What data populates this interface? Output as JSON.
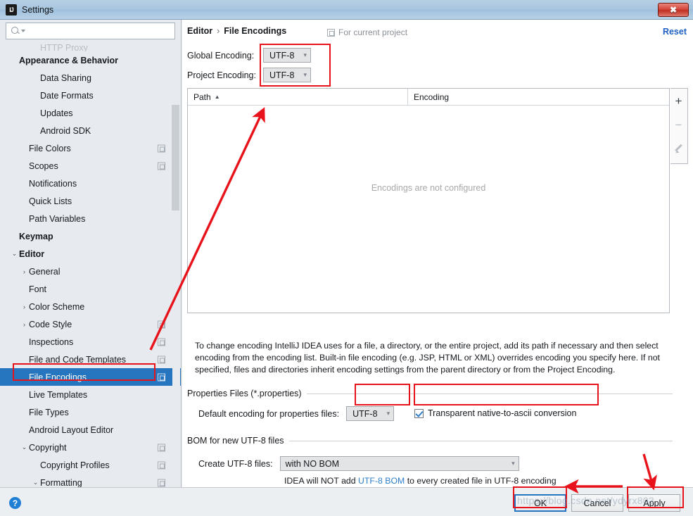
{
  "window": {
    "title": "Settings",
    "app_icon": "intellij-idea-icon",
    "close_label": "✖"
  },
  "sidebar": {
    "search": {
      "placeholder": "",
      "value": "",
      "icon": "search-icon"
    },
    "items": [
      {
        "label": "HTTP Proxy",
        "indent": 2,
        "kind": "clipped",
        "arrow": "",
        "badge": false
      },
      {
        "label": "Appearance & Behavior",
        "indent": 0,
        "kind": "group",
        "arrow": "",
        "badge": false
      },
      {
        "label": "Data Sharing",
        "indent": 2,
        "kind": "leaf",
        "arrow": "",
        "badge": false
      },
      {
        "label": "Date Formats",
        "indent": 2,
        "kind": "leaf",
        "arrow": "",
        "badge": false
      },
      {
        "label": "Updates",
        "indent": 2,
        "kind": "leaf",
        "arrow": "",
        "badge": false
      },
      {
        "label": "Android SDK",
        "indent": 2,
        "kind": "leaf",
        "arrow": "",
        "badge": false
      },
      {
        "label": "File Colors",
        "indent": 1,
        "kind": "leaf",
        "arrow": "",
        "badge": true
      },
      {
        "label": "Scopes",
        "indent": 1,
        "kind": "leaf",
        "arrow": "",
        "badge": true
      },
      {
        "label": "Notifications",
        "indent": 1,
        "kind": "leaf",
        "arrow": "",
        "badge": false
      },
      {
        "label": "Quick Lists",
        "indent": 1,
        "kind": "leaf",
        "arrow": "",
        "badge": false
      },
      {
        "label": "Path Variables",
        "indent": 1,
        "kind": "leaf",
        "arrow": "",
        "badge": false
      },
      {
        "label": "Keymap",
        "indent": 0,
        "kind": "group",
        "arrow": "",
        "badge": false
      },
      {
        "label": "Editor",
        "indent": 0,
        "kind": "group",
        "arrow": "⌄",
        "badge": false
      },
      {
        "label": "General",
        "indent": 1,
        "kind": "leaf",
        "arrow": "›",
        "badge": false
      },
      {
        "label": "Font",
        "indent": 1,
        "kind": "leaf",
        "arrow": "",
        "badge": false
      },
      {
        "label": "Color Scheme",
        "indent": 1,
        "kind": "leaf",
        "arrow": "›",
        "badge": false
      },
      {
        "label": "Code Style",
        "indent": 1,
        "kind": "leaf",
        "arrow": "›",
        "badge": true
      },
      {
        "label": "Inspections",
        "indent": 1,
        "kind": "leaf",
        "arrow": "",
        "badge": true
      },
      {
        "label": "File and Code Templates",
        "indent": 1,
        "kind": "leaf",
        "arrow": "",
        "badge": true
      },
      {
        "label": "File Encodings",
        "indent": 1,
        "kind": "selected",
        "arrow": "",
        "badge": true
      },
      {
        "label": "Live Templates",
        "indent": 1,
        "kind": "leaf",
        "arrow": "",
        "badge": false
      },
      {
        "label": "File Types",
        "indent": 1,
        "kind": "leaf",
        "arrow": "",
        "badge": false
      },
      {
        "label": "Android Layout Editor",
        "indent": 1,
        "kind": "leaf",
        "arrow": "",
        "badge": false
      },
      {
        "label": "Copyright",
        "indent": 1,
        "kind": "leaf",
        "arrow": "⌄",
        "badge": true
      },
      {
        "label": "Copyright Profiles",
        "indent": 2,
        "kind": "leaf",
        "arrow": "",
        "badge": true
      },
      {
        "label": "Formatting",
        "indent": 2,
        "kind": "leaf",
        "arrow": "⌄",
        "badge": true
      }
    ]
  },
  "content": {
    "breadcrumb": {
      "root": "Editor",
      "separator": "›",
      "leaf": "File Encodings"
    },
    "scope_note": {
      "text": "For current project",
      "icon": "scope-copy-icon"
    },
    "reset_label": "Reset",
    "global_encoding": {
      "label": "Global Encoding:",
      "value": "UTF-8"
    },
    "project_encoding": {
      "label": "Project Encoding:",
      "value": "UTF-8"
    },
    "table": {
      "columns": [
        "Path",
        "Encoding"
      ],
      "sort_indicator": "▲",
      "rows": [],
      "empty_message": "Encodings are not configured",
      "buttons": [
        {
          "name": "add-encoding-button",
          "glyph": "+",
          "enabled": true
        },
        {
          "name": "remove-encoding-button",
          "glyph": "−",
          "enabled": false
        },
        {
          "name": "edit-encoding-button",
          "glyph": "pencil",
          "enabled": false
        }
      ]
    },
    "description": "To change encoding IntelliJ IDEA uses for a file, a directory, or the entire project, add its path if necessary and then select encoding from the encoding list. Built-in file encoding (e.g. JSP, HTML or XML) overrides encoding you specify here. If not specified, files and directories inherit encoding settings from the parent directory or from the Project Encoding.",
    "properties_section": {
      "title": "Properties Files (*.properties)",
      "default_encoding_label": "Default encoding for properties files:",
      "default_encoding_value": "UTF-8",
      "transparent_label": "Transparent native-to-ascii conversion",
      "transparent_checked": true
    },
    "bom_section": {
      "title": "BOM for new UTF-8 files",
      "create_label": "Create UTF-8 files:",
      "create_value": "with NO BOM",
      "hint_prefix": "IDEA will NOT add ",
      "hint_link": "UTF-8 BOM",
      "hint_suffix": " to every created file in UTF-8 encoding"
    }
  },
  "footer": {
    "help_glyph": "?",
    "ok_label": "OK",
    "cancel_label": "Cancel",
    "apply_label": "Apply"
  },
  "annotations": {
    "accent_red": "#e8131a",
    "watermark": "https://blog.csdn.net/ydyrx803"
  }
}
